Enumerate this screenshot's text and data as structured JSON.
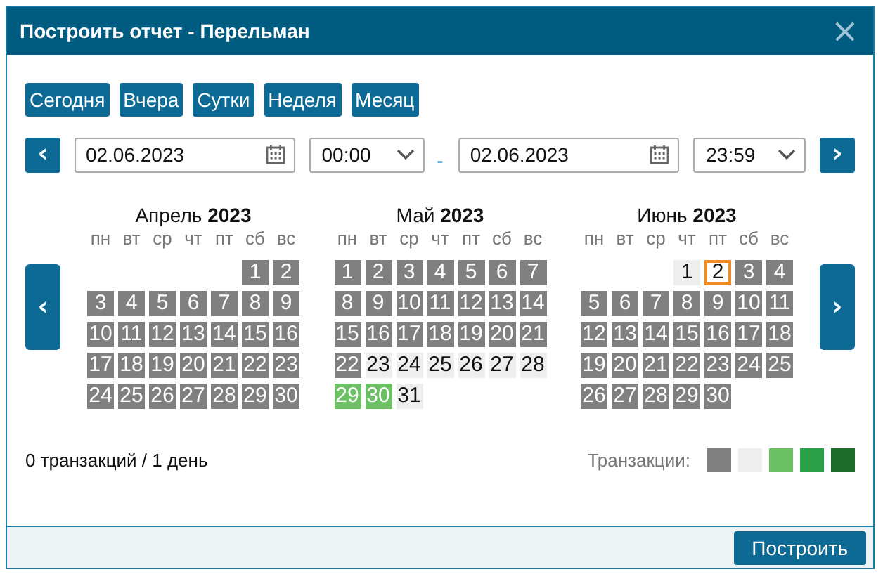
{
  "window": {
    "title": "Построить отчет - Перельман",
    "close": "×"
  },
  "quick_buttons": [
    "Сегодня",
    "Вчера",
    "Сутки",
    "Неделя",
    "Месяц"
  ],
  "range": {
    "prev": "‹",
    "from_date": "02.06.2023",
    "from_time": "00:00",
    "separator": "-",
    "to_date": "02.06.2023",
    "to_time": "23:59",
    "next": "›"
  },
  "calendar": {
    "prev": "‹",
    "next": "›",
    "months": [
      {
        "name": "Апрель",
        "year": "2023",
        "weekdays": [
          "пн",
          "вт",
          "ср",
          "чт",
          "пт",
          "сб",
          "вс"
        ],
        "weeks": [
          [
            {
              "day": "1",
              "color": "#808080",
              "selected": false
            },
            {
              "day": "2",
              "color": "#808080",
              "selected": false
            }
          ],
          [
            {
              "day": "3",
              "color": "#808080",
              "selected": false
            },
            {
              "day": "4",
              "color": "#808080",
              "selected": false
            },
            {
              "day": "5",
              "color": "#808080",
              "selected": false
            },
            {
              "day": "6",
              "color": "#808080",
              "selected": false
            },
            {
              "day": "7",
              "color": "#808080",
              "selected": false
            },
            {
              "day": "8",
              "color": "#808080",
              "selected": false
            },
            {
              "day": "9",
              "color": "#808080",
              "selected": false
            }
          ],
          [
            {
              "day": "10",
              "color": "#808080",
              "selected": false
            },
            {
              "day": "11",
              "color": "#808080",
              "selected": false
            },
            {
              "day": "12",
              "color": "#808080",
              "selected": false
            },
            {
              "day": "13",
              "color": "#808080",
              "selected": false
            },
            {
              "day": "14",
              "color": "#808080",
              "selected": false
            },
            {
              "day": "15",
              "color": "#808080",
              "selected": false
            },
            {
              "day": "16",
              "color": "#808080",
              "selected": false
            }
          ],
          [
            {
              "day": "17",
              "color": "#808080",
              "selected": false
            },
            {
              "day": "18",
              "color": "#808080",
              "selected": false
            },
            {
              "day": "19",
              "color": "#808080",
              "selected": false
            },
            {
              "day": "20",
              "color": "#808080",
              "selected": false
            },
            {
              "day": "21",
              "color": "#808080",
              "selected": false
            },
            {
              "day": "22",
              "color": "#808080",
              "selected": false
            },
            {
              "day": "23",
              "color": "#808080",
              "selected": false
            }
          ],
          [
            {
              "day": "24",
              "color": "#808080",
              "selected": false
            },
            {
              "day": "25",
              "color": "#808080",
              "selected": false
            },
            {
              "day": "26",
              "color": "#808080",
              "selected": false
            },
            {
              "day": "27",
              "color": "#808080",
              "selected": false
            },
            {
              "day": "28",
              "color": "#808080",
              "selected": false
            },
            {
              "day": "29",
              "color": "#808080",
              "selected": false
            },
            {
              "day": "30",
              "color": "#808080",
              "selected": false
            }
          ]
        ]
      },
      {
        "name": "Май",
        "year": "2023",
        "weekdays": [
          "пн",
          "вт",
          "ср",
          "чт",
          "пт",
          "сб",
          "вс"
        ],
        "weeks": [
          [
            {
              "day": "1",
              "color": "#808080",
              "selected": false
            },
            {
              "day": "2",
              "color": "#808080",
              "selected": false
            },
            {
              "day": "3",
              "color": "#808080",
              "selected": false
            },
            {
              "day": "4",
              "color": "#808080",
              "selected": false
            },
            {
              "day": "5",
              "color": "#808080",
              "selected": false
            },
            {
              "day": "6",
              "color": "#808080",
              "selected": false
            },
            {
              "day": "7",
              "color": "#808080",
              "selected": false
            }
          ],
          [
            {
              "day": "8",
              "color": "#808080",
              "selected": false
            },
            {
              "day": "9",
              "color": "#808080",
              "selected": false
            },
            {
              "day": "10",
              "color": "#808080",
              "selected": false
            },
            {
              "day": "11",
              "color": "#808080",
              "selected": false
            },
            {
              "day": "12",
              "color": "#808080",
              "selected": false
            },
            {
              "day": "13",
              "color": "#808080",
              "selected": false
            },
            {
              "day": "14",
              "color": "#808080",
              "selected": false
            }
          ],
          [
            {
              "day": "15",
              "color": "#808080",
              "selected": false
            },
            {
              "day": "16",
              "color": "#808080",
              "selected": false
            },
            {
              "day": "17",
              "color": "#808080",
              "selected": false
            },
            {
              "day": "18",
              "color": "#808080",
              "selected": false
            },
            {
              "day": "19",
              "color": "#808080",
              "selected": false
            },
            {
              "day": "20",
              "color": "#808080",
              "selected": false
            },
            {
              "day": "21",
              "color": "#808080",
              "selected": false
            }
          ],
          [
            {
              "day": "22",
              "color": "#808080",
              "selected": false
            },
            {
              "day": "23",
              "color": "#eeeeee",
              "selected": false
            },
            {
              "day": "24",
              "color": "#eeeeee",
              "selected": false
            },
            {
              "day": "25",
              "color": "#eeeeee",
              "selected": false
            },
            {
              "day": "26",
              "color": "#eeeeee",
              "selected": false
            },
            {
              "day": "27",
              "color": "#eeeeee",
              "selected": false
            },
            {
              "day": "28",
              "color": "#eeeeee",
              "selected": false
            }
          ],
          [
            {
              "day": "29",
              "color": "#6cc164",
              "selected": false
            },
            {
              "day": "30",
              "color": "#6cc164",
              "selected": false
            },
            {
              "day": "31",
              "color": "#eeeeee",
              "selected": false
            }
          ]
        ]
      },
      {
        "name": "Июнь",
        "year": "2023",
        "weekdays": [
          "пн",
          "вт",
          "ср",
          "чт",
          "пт",
          "сб",
          "вс"
        ],
        "weeks": [
          [
            {
              "day": "1",
              "color": "#eeeeee",
              "selected": false
            },
            {
              "day": "2",
              "selected": true
            },
            {
              "day": "3",
              "color": "#808080",
              "selected": false
            },
            {
              "day": "4",
              "color": "#808080",
              "selected": false
            }
          ],
          [
            {
              "day": "5",
              "color": "#808080",
              "selected": false
            },
            {
              "day": "6",
              "color": "#808080",
              "selected": false
            },
            {
              "day": "7",
              "color": "#808080",
              "selected": false
            },
            {
              "day": "8",
              "color": "#808080",
              "selected": false
            },
            {
              "day": "9",
              "color": "#808080",
              "selected": false
            },
            {
              "day": "10",
              "color": "#808080",
              "selected": false
            },
            {
              "day": "11",
              "color": "#808080",
              "selected": false
            }
          ],
          [
            {
              "day": "12",
              "color": "#808080",
              "selected": false
            },
            {
              "day": "13",
              "color": "#808080",
              "selected": false
            },
            {
              "day": "14",
              "color": "#808080",
              "selected": false
            },
            {
              "day": "15",
              "color": "#808080",
              "selected": false
            },
            {
              "day": "16",
              "color": "#808080",
              "selected": false
            },
            {
              "day": "17",
              "color": "#808080",
              "selected": false
            },
            {
              "day": "18",
              "color": "#808080",
              "selected": false
            }
          ],
          [
            {
              "day": "19",
              "color": "#808080",
              "selected": false
            },
            {
              "day": "20",
              "color": "#808080",
              "selected": false
            },
            {
              "day": "21",
              "color": "#808080",
              "selected": false
            },
            {
              "day": "22",
              "color": "#808080",
              "selected": false
            },
            {
              "day": "23",
              "color": "#808080",
              "selected": false
            },
            {
              "day": "24",
              "color": "#808080",
              "selected": false
            },
            {
              "day": "25",
              "color": "#808080",
              "selected": false
            }
          ],
          [
            {
              "day": "26",
              "color": "#808080",
              "selected": false
            },
            {
              "day": "27",
              "color": "#808080",
              "selected": false
            },
            {
              "day": "28",
              "color": "#808080",
              "selected": false
            },
            {
              "day": "29",
              "color": "#808080",
              "selected": false
            },
            {
              "day": "30",
              "color": "#808080",
              "selected": false
            }
          ]
        ]
      }
    ]
  },
  "summary": "0 транзакций / 1 день",
  "legend": {
    "label": "Транзакции:",
    "items": [
      {
        "color": "#808080"
      },
      {
        "color": "#eeeeee"
      },
      {
        "color": "#6cc164"
      },
      {
        "color": "#2aa149"
      },
      {
        "color": "#1f6b2a"
      }
    ]
  },
  "footer": {
    "button": "Построить"
  }
}
